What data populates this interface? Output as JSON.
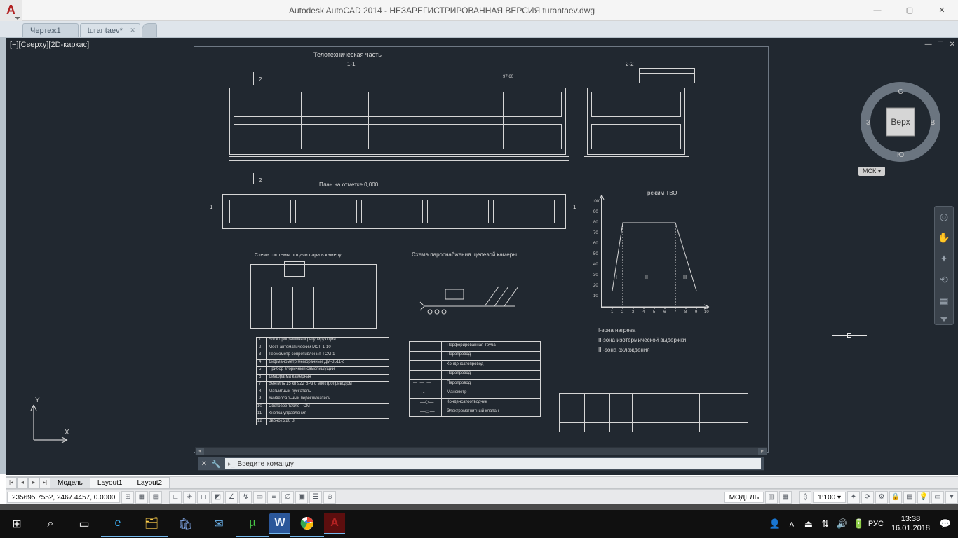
{
  "title": "Autodesk AutoCAD 2014 - НЕЗАРЕГИСТРИРОВАННАЯ ВЕРСИЯ    turantaev.dwg",
  "tabs": {
    "t0": "Чертеж1",
    "t1": "turantaev*"
  },
  "viewport_label": "[−][Сверху][2D-каркас]",
  "viewcube": {
    "top": "С",
    "right": "В",
    "bottom": "Ю",
    "left": "З",
    "center": "Верх",
    "ucs": "МСК ▾"
  },
  "layout_tabs": {
    "model": "Модель",
    "l1": "Layout1",
    "l2": "Layout2"
  },
  "coords": "235695.7552, 2467.4457, 0.0000",
  "status": {
    "model": "МОДЕЛЬ",
    "scale": "1:100 ▾"
  },
  "command_placeholder": "Введите команду",
  "tray": {
    "lang": "РУС",
    "time": "13:38",
    "date": "16.01.2018"
  },
  "drawing": {
    "title": "Телотехническая часть",
    "sec11": "1-1",
    "sec22": "2-2",
    "plan": "План на отметке 0,000",
    "schema1": "Схема системы подачи пара в камеру",
    "schema2": "Схема пароснабжения щелевой камеры",
    "mode": "режим ТВО",
    "zone1": "I-зона нагрева",
    "zone2": "II-зона изотермической выдержки",
    "zone3": "III-зона охлаждения",
    "label_z1": "I",
    "label_z2": "II",
    "label_z3": "III",
    "mark2": "2",
    "mark1": "1",
    "dim9760": "97.60"
  },
  "legend1": {
    "h1": "1",
    "r1": "Блок программный регулирующий",
    "h2": "2",
    "r2": "Мост автоматический МСГ-1-10",
    "h3": "3",
    "r3": "Термометр сопротивления ТСМ-1",
    "h4": "4",
    "r4": "Дифманометр мембранный ДМ-3511-с",
    "h5": "5",
    "r5": "Прибор вторичный самопишущий",
    "h6": "6",
    "r6": "Диафрагма камерная",
    "h7": "7",
    "r7": "Вентиль 15 кп 922 ВРз с электроприводом",
    "h8": "8",
    "r8": "Магнитный пускатель",
    "h9": "9",
    "r9": "Универсальный переключатель",
    "h10": "10",
    "r10": "Световое табло ТСМ",
    "h11": "11",
    "r11": "Кнопка управления",
    "h12": "12",
    "r12": "Звонок 220 В"
  },
  "legend2": {
    "r1": "Перфорированная труба",
    "r2": "Паропровод",
    "r3": "Конденсатопровод",
    "r4": "Паропровод",
    "r5": "Паропровод",
    "r6": "Манометр",
    "r7": "Конденсатоотводчик",
    "r8": "Электромагнитный клапан"
  },
  "chart_data": {
    "type": "line",
    "title": "режим ТВО",
    "xlabel": "",
    "ylabel": "",
    "x": [
      1,
      2,
      3,
      4,
      5,
      6,
      7,
      8,
      9,
      10
    ],
    "ylim": [
      0,
      100
    ],
    "y_ticks": [
      10,
      20,
      30,
      40,
      50,
      60,
      70,
      80,
      90,
      100
    ],
    "series": [
      {
        "name": "режим ТВО",
        "points": [
          [
            1,
            15
          ],
          [
            2,
            80
          ],
          [
            7,
            80
          ],
          [
            9,
            15
          ]
        ]
      }
    ],
    "regions": [
      {
        "name": "I",
        "x_range": [
          1,
          2
        ]
      },
      {
        "name": "II",
        "x_range": [
          2,
          7
        ]
      },
      {
        "name": "III",
        "x_range": [
          7,
          9
        ]
      }
    ]
  }
}
